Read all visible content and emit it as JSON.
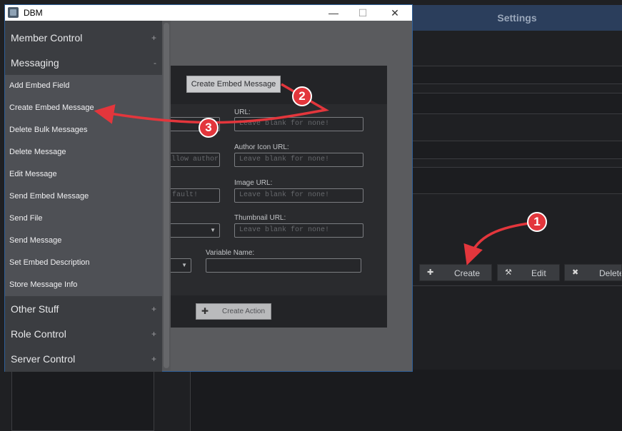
{
  "background_app": {
    "settings_title": "Settings",
    "buttons": {
      "create_label": "Create",
      "edit_label": "Edit",
      "delete_label": "Delete"
    }
  },
  "window": {
    "title": "DBM",
    "controls": {
      "minimize": "—",
      "maximize": "☐",
      "close": "✕"
    }
  },
  "dialog": {
    "create_embed_button": "Create Embed Message",
    "fields": {
      "url_label": "URL:",
      "url_placeholder": "Leave blank for none!",
      "author_icon_url_label": "Author Icon URL:",
      "author_icon_url_placeholder": "Leave blank for none!",
      "image_url_label": "Image URL:",
      "image_url_placeholder": "Leave blank for none!",
      "thumbnail_url_label": "Thumbnail URL:",
      "thumbnail_url_placeholder": "Leave blank for none!",
      "variable_name_label": "Variable Name:",
      "partial_left_1": "allow author",
      "partial_left_2": "fault!"
    },
    "create_action_label": "Create Action"
  },
  "menu": {
    "categories_top": [
      {
        "label": "Member Control",
        "sign": "+"
      },
      {
        "label": "Messaging",
        "sign": "-"
      }
    ],
    "messaging_items": [
      "Add Embed Field",
      "Create Embed Message",
      "Delete Bulk Messages",
      "Delete Message",
      "Edit Message",
      "Send Embed Message",
      "Send File",
      "Send Message",
      "Set Embed Description",
      "Store Message Info"
    ],
    "categories_bottom": [
      {
        "label": "Other Stuff",
        "sign": "+"
      },
      {
        "label": "Role Control",
        "sign": "+"
      },
      {
        "label": "Server Control",
        "sign": "+"
      }
    ]
  },
  "annotations": {
    "step_1": "1",
    "step_2": "2",
    "step_3": "3",
    "arrow_color": "#e3363c"
  },
  "colors": {
    "window_border": "#2f5f98",
    "menu_bg": "#3b3d41",
    "submenu_bg": "#4e5055",
    "settings_bar": "#2b3e5c"
  }
}
